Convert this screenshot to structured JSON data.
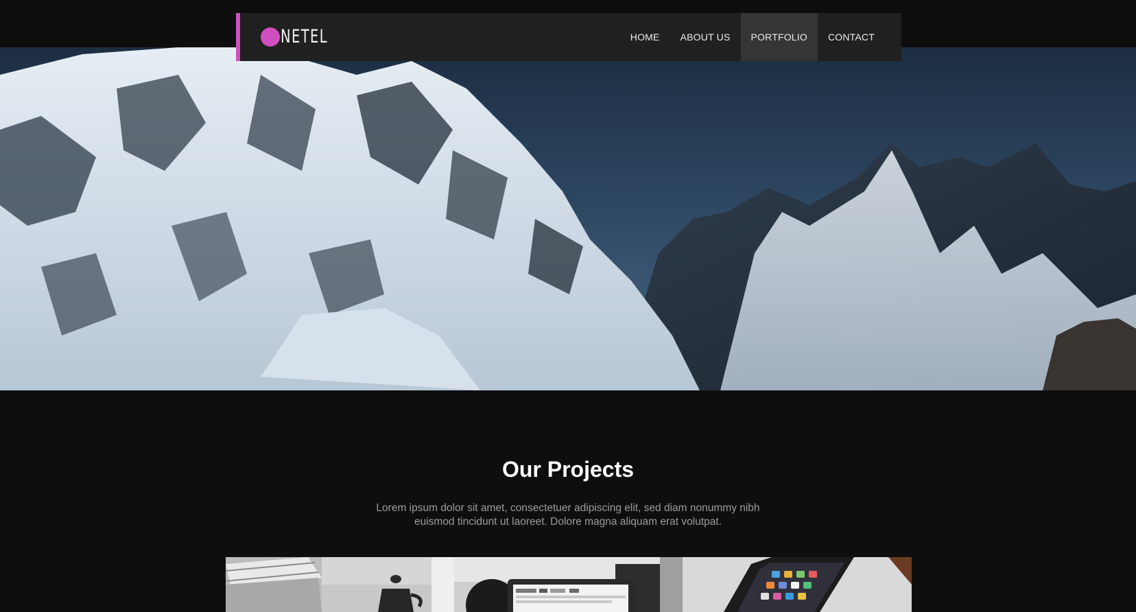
{
  "brand": {
    "logo_text": "NETEL",
    "accent_color": "#cf4fc0"
  },
  "nav": {
    "items": [
      {
        "label": "HOME",
        "active": false
      },
      {
        "label": "ABOUT US",
        "active": false
      },
      {
        "label": "PORTFOLIO",
        "active": true
      },
      {
        "label": "CONTACT",
        "active": false
      }
    ]
  },
  "hero": {
    "image": "snowy-mountain-range"
  },
  "projects": {
    "title": "Our Projects",
    "description": "Lorem ipsum dolor sit amet, consectetuer adipiscing elit, sed diam nonummy nibh euismod tincidunt ut laoreet. Dolore magna aliquam erat volutpat.",
    "thumbnails": [
      {
        "image": "magazines-and-coffee-pot"
      },
      {
        "image": "person-at-laptop"
      },
      {
        "image": "smartphone-on-wood"
      }
    ]
  },
  "colors": {
    "page_background": "#0e0e0e",
    "navbar_background": "#202020",
    "nav_active_background": "#353535"
  }
}
